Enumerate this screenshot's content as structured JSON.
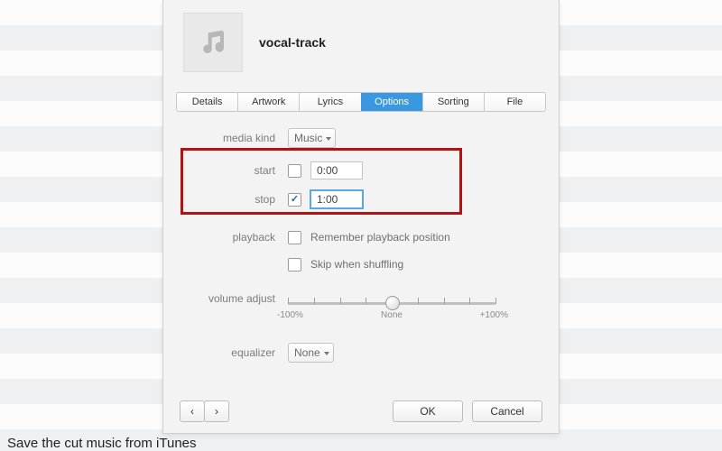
{
  "header": {
    "track_title": "vocal-track"
  },
  "tabs": {
    "items": [
      {
        "label": "Details",
        "active": false
      },
      {
        "label": "Artwork",
        "active": false
      },
      {
        "label": "Lyrics",
        "active": false
      },
      {
        "label": "Options",
        "active": true
      },
      {
        "label": "Sorting",
        "active": false
      },
      {
        "label": "File",
        "active": false
      }
    ]
  },
  "options": {
    "media_kind_label": "media kind",
    "media_kind_value": "Music",
    "start_label": "start",
    "start_checked": false,
    "start_value": "0:00",
    "stop_label": "stop",
    "stop_checked": true,
    "stop_value": "1:00",
    "playback_label": "playback",
    "remember_label": "Remember playback position",
    "remember_checked": false,
    "skip_label": "Skip when shuffling",
    "skip_checked": false,
    "volume_label": "volume adjust",
    "volume_left": "-100%",
    "volume_center": "None",
    "volume_right": "+100%",
    "equalizer_label": "equalizer",
    "equalizer_value": "None"
  },
  "buttons": {
    "prev": "‹",
    "next": "›",
    "ok": "OK",
    "cancel": "Cancel"
  },
  "caption": "Save the cut music from iTunes"
}
